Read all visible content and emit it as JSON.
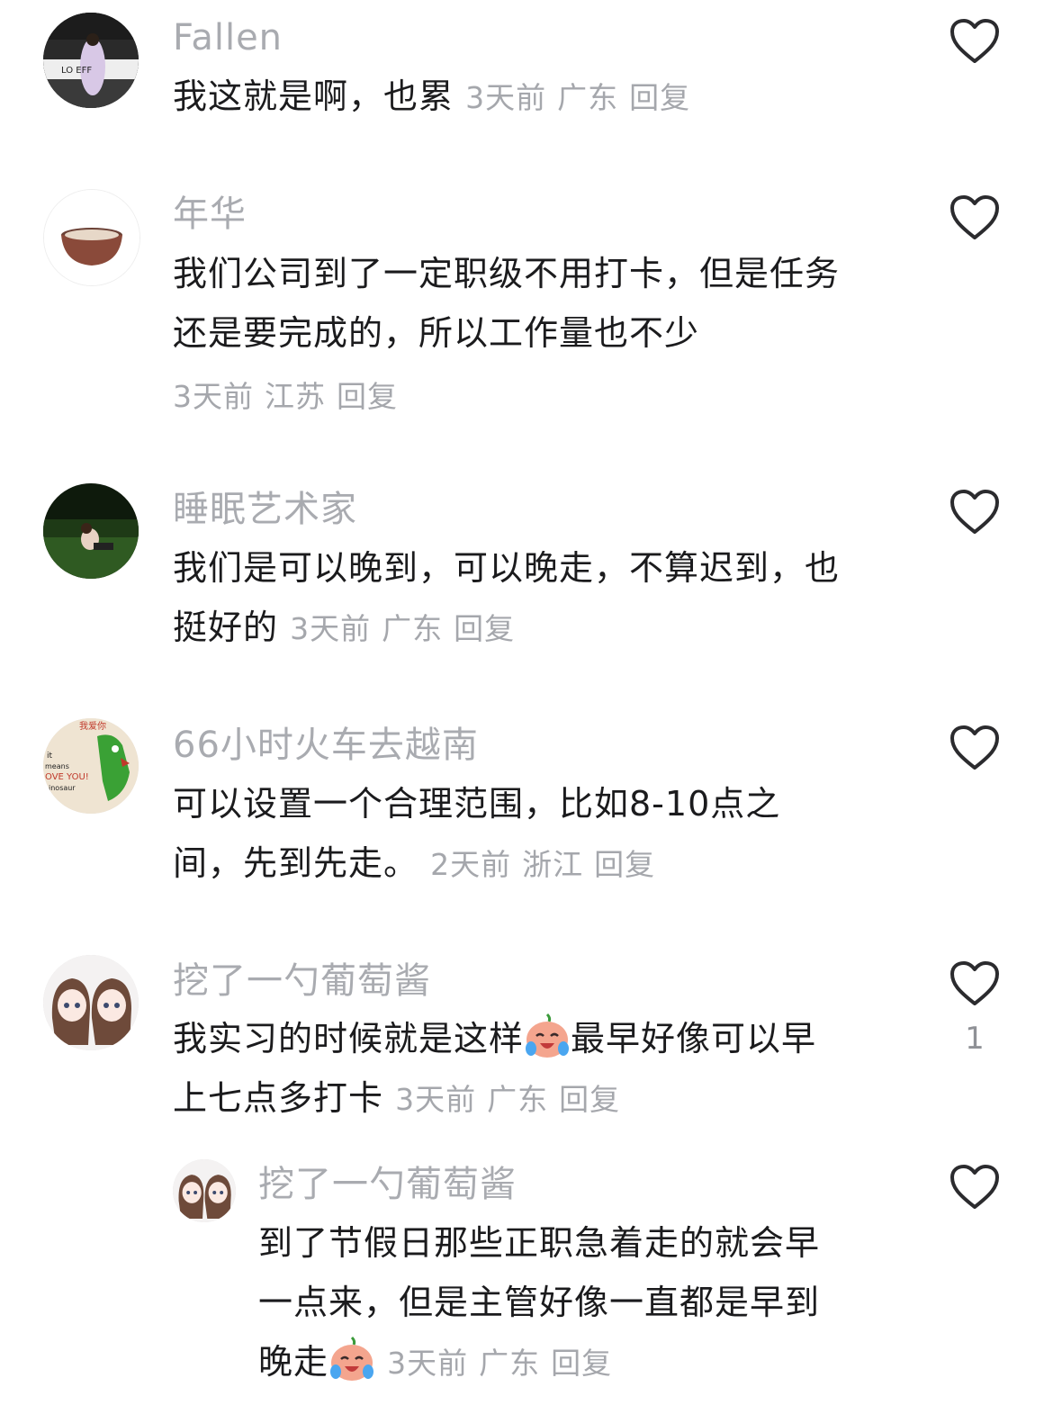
{
  "comments": [
    {
      "username": "Fallen",
      "text": "我这就是啊，也累",
      "time": "3天前",
      "location": "广东",
      "reply": "回复",
      "likes": ""
    },
    {
      "username": "年华",
      "text_line1": "我们公司到了一定职级不用打卡，但是任务",
      "text_line2": "还是要完成的，所以工作量也不少",
      "time": "3天前",
      "location": "江苏",
      "reply": "回复",
      "likes": ""
    },
    {
      "username": "睡眠艺术家",
      "text_line1": "我们是可以晚到，可以晚走，不算迟到，也",
      "text_line2": "挺好的",
      "time": "3天前",
      "location": "广东",
      "reply": "回复",
      "likes": ""
    },
    {
      "username": "66小时火车去越南",
      "text_line1": "可以设置一个合理范围，比如8-10点之",
      "text_line2": "间，先到先走。",
      "time": "2天前",
      "location": "浙江",
      "reply": "回复",
      "likes": ""
    },
    {
      "username": "挖了一勺葡萄酱",
      "text_line1a": "我实习的时候就是这样",
      "text_line1b": "最早好像可以早",
      "text_line2": "上七点多打卡",
      "time": "3天前",
      "location": "广东",
      "reply": "回复",
      "likes": "1",
      "emoji": "crying-laughing-face-icon"
    },
    {
      "username": "挖了一勺葡萄酱",
      "text_line1": "到了节假日那些正职急着走的就会早",
      "text_line2": "一点来，但是主管好像一直都是早到",
      "text_line3": "晚走",
      "time": "3天前",
      "location": "广东",
      "reply": "回复",
      "likes": "",
      "emoji": "crying-laughing-face-icon"
    }
  ],
  "colors": {
    "text": "#1b1b1d",
    "secondary": "#a9abb0",
    "heart_stroke": "#2b2b2e"
  }
}
